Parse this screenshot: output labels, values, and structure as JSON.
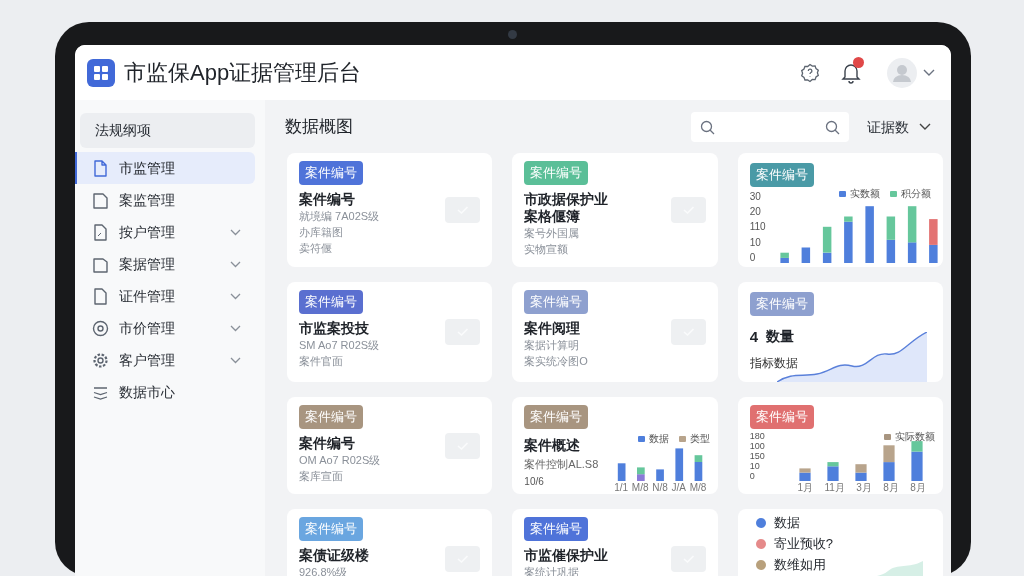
{
  "header": {
    "title": "市监保App证据管理后台"
  },
  "sidebar": {
    "heading": "法规纲项",
    "items": [
      {
        "label": "市监管理",
        "selected": true,
        "has_submenu": false
      },
      {
        "label": "案监管理",
        "selected": false,
        "has_submenu": false
      },
      {
        "label": "按户管理",
        "selected": false,
        "has_submenu": true
      },
      {
        "label": "案据管理",
        "selected": false,
        "has_submenu": true
      },
      {
        "label": "证件管理",
        "selected": false,
        "has_submenu": true
      },
      {
        "label": "市价管理",
        "selected": false,
        "has_submenu": true
      },
      {
        "label": "客户管理",
        "selected": false,
        "has_submenu": true
      },
      {
        "label": "数据市心",
        "selected": false,
        "has_submenu": false
      }
    ]
  },
  "main": {
    "title": "数据概图",
    "filter": "证据数"
  },
  "cards": [
    {
      "kind": "record",
      "tag": "案件编号",
      "color": "#4f73d9",
      "title": [
        "案件编号"
      ],
      "lines": [
        "就境编 7A02S级",
        "办库籍图",
        "卖符偃"
      ],
      "checked": false
    },
    {
      "kind": "record",
      "tag": "案件编号",
      "color": "#5bbf98",
      "title": [
        "市政据保护业",
        "案格偃簿"
      ],
      "lines": [
        "案号外国属",
        "实物宣额"
      ],
      "checked": false
    },
    {
      "kind": "bars",
      "tag": "案件编号",
      "color": "#4a9aa6",
      "ticks": [
        "30",
        "20",
        "110",
        "10",
        "0"
      ],
      "legend": [
        {
          "name": "实数额",
          "color": "#4f7fdc"
        },
        {
          "name": "积分额",
          "color": "#66c79c"
        }
      ]
    },
    {
      "kind": "record",
      "tag": "案件编号",
      "color": "#5a6fd0",
      "title": [
        "市监案投技"
      ],
      "lines": [
        "SM Ao7 R02S级",
        "案件官面"
      ],
      "checked": false
    },
    {
      "kind": "record",
      "tag": "案件编号",
      "color": "#8ea0cf",
      "title": [
        "案件阅理"
      ],
      "lines": [
        "案据计算明",
        "案实统冷图O"
      ],
      "checked": false
    },
    {
      "kind": "trend",
      "tag": "案件编号",
      "color": "#8ea0cf",
      "value": "4",
      "label": "数量",
      "caption": "指标数据"
    },
    {
      "kind": "record",
      "tag": "案件编号",
      "color": "#a89580",
      "title": [
        "案件编号"
      ],
      "lines": [
        "OM Ao7 R02S级",
        "案库宣面"
      ],
      "checked": false
    },
    {
      "kind": "minibars",
      "tag": "案件编号",
      "color": "#a89580",
      "title": "案件概述",
      "line": "案件控制AL.S8",
      "tick": "10/6",
      "legend": [
        {
          "name": "数据",
          "color": "#4f7fdc"
        },
        {
          "name": "类型",
          "color": "#b8a48c"
        }
      ],
      "xlabels": [
        "1/1",
        "M/8",
        "N/8",
        "J/A",
        "M/8"
      ]
    },
    {
      "kind": "bars2",
      "tag": "案件编号",
      "color": "#e07070",
      "ticks": [
        "180",
        "100",
        "150",
        "10",
        "0"
      ],
      "legend": [
        {
          "name": "实际数额",
          "color": "#a89580"
        }
      ],
      "xlabels": [
        "1月",
        "11月",
        "3月",
        "8月",
        "8月"
      ]
    },
    {
      "kind": "record",
      "tag": "案件编号",
      "color": "#6aa6e0",
      "title": [
        "案债证级楼"
      ],
      "lines": [
        "926.8%级"
      ],
      "checked": false
    },
    {
      "kind": "record",
      "tag": "案件编号",
      "color": "#4f73d9",
      "title": [
        "市监催保护业"
      ],
      "lines": [
        "案统计巩据"
      ],
      "checked": false
    },
    {
      "kind": "legend",
      "items": [
        {
          "label": "数据",
          "color": "#4f7fdc"
        },
        {
          "label": "寄业预收?",
          "color": "#e58a8a"
        },
        {
          "label": "数维如用",
          "color": "#b8a07c"
        }
      ]
    }
  ]
}
